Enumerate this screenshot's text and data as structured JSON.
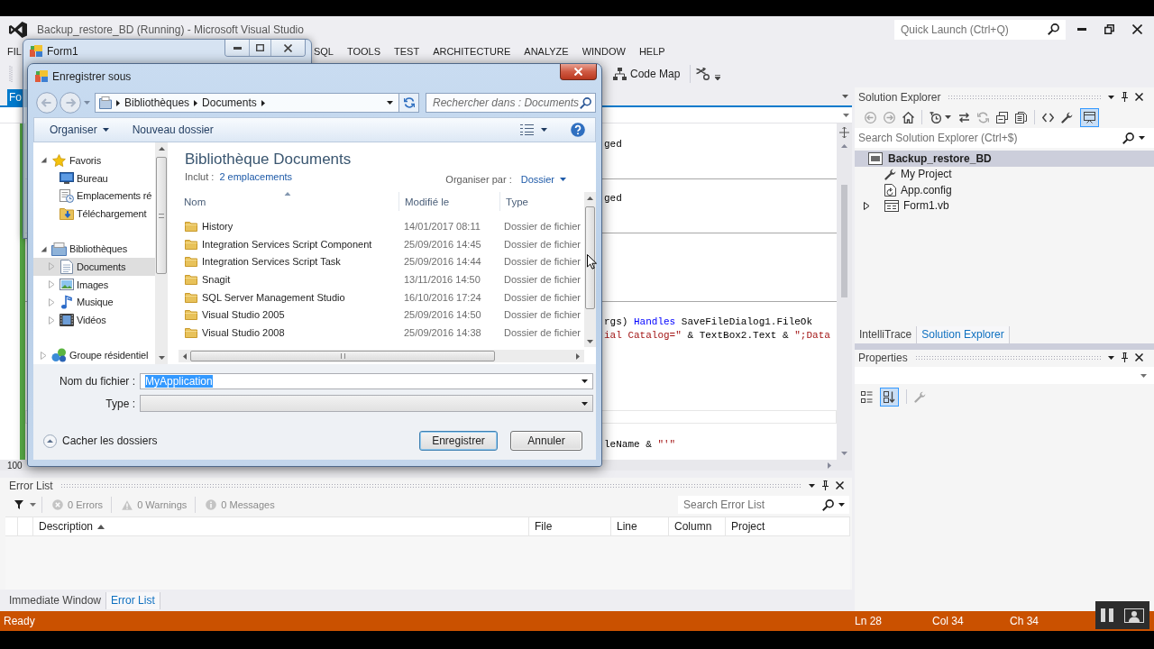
{
  "ide": {
    "title": "Backup_restore_BD (Running) - Microsoft Visual Studio",
    "quick_launch": {
      "placeholder": "Quick Launch (Ctrl+Q)"
    }
  },
  "menu": [
    {
      "label": "FIL"
    },
    {
      "label": "SQL"
    },
    {
      "label": "TOOLS"
    },
    {
      "label": "TEST"
    },
    {
      "label": "ARCHITECTURE"
    },
    {
      "label": "ANALYZE"
    },
    {
      "label": "WINDOW"
    },
    {
      "label": "HELP"
    }
  ],
  "toolbar": {
    "code_map": "Code Map"
  },
  "document_tab": {
    "label": "Fo",
    "selected": true
  },
  "editor": {
    "lines": [
      {
        "tokens": [
          {
            "kind": "plain",
            "text": "ged"
          }
        ]
      },
      {
        "tokens": [
          {
            "kind": "plain",
            "text": "ged"
          }
        ]
      },
      {
        "tokens": [
          {
            "kind": "plain",
            "text": "rgs) "
          },
          {
            "kind": "keyword",
            "text": "Handles"
          },
          {
            "kind": "plain",
            "text": " SaveFileDialog1.FileOk"
          }
        ]
      },
      {
        "tokens": [
          {
            "kind": "string",
            "text": "ial Catalog=\""
          },
          {
            "kind": "plain",
            "text": " & TextBox2.Text & "
          },
          {
            "kind": "string",
            "text": "\";Data"
          }
        ]
      },
      {
        "tokens": [
          {
            "kind": "plain",
            "text": "leName & "
          },
          {
            "kind": "string",
            "text": "\"'\""
          }
        ]
      }
    ],
    "zoom": "100"
  },
  "form_window": {
    "title": "Form1"
  },
  "dialog": {
    "title": "Enregistrer sous",
    "breadcrumb": [
      {
        "label": "Bibliothèques"
      },
      {
        "label": "Documents"
      }
    ],
    "search": {
      "placeholder": "Rechercher dans : Documents"
    },
    "commands": [
      {
        "label": "Organiser",
        "menu": true
      },
      {
        "label": "Nouveau dossier",
        "menu": false
      }
    ],
    "nav": [
      {
        "label": "Favoris",
        "kind": "favorites",
        "selected": false,
        "expanded": true,
        "children": [
          {
            "label": "Bureau",
            "kind": "desktop",
            "selected": false
          },
          {
            "label": "Emplacements ré",
            "kind": "recent",
            "selected": false
          },
          {
            "label": "Téléchargement",
            "kind": "downloads",
            "selected": false
          }
        ]
      },
      {
        "label": "Bibliothèques",
        "kind": "libraries",
        "selected": false,
        "expanded": true,
        "children": [
          {
            "label": "Documents",
            "kind": "documents",
            "selected": true,
            "expanded": false
          },
          {
            "label": "Images",
            "kind": "pictures",
            "selected": false,
            "expanded": false
          },
          {
            "label": "Musique",
            "kind": "music",
            "selected": false,
            "expanded": false
          },
          {
            "label": "Vidéos",
            "kind": "videos",
            "selected": false,
            "expanded": false
          }
        ]
      },
      {
        "label": "Groupe résidentiel",
        "kind": "homegroup",
        "selected": false,
        "expanded": false
      }
    ],
    "library": {
      "title": "Bibliothèque Documents",
      "includes_label": "Inclut :",
      "includes_link": "2 emplacements",
      "arrange_label": "Organiser par :",
      "arrange_value": "Dossier"
    },
    "columns": [
      {
        "label": "Nom",
        "sorted": true
      },
      {
        "label": "Modifié le",
        "sorted": false
      },
      {
        "label": "Type",
        "sorted": false
      }
    ],
    "files": [
      {
        "name": "History",
        "modified": "14/01/2017 08:11",
        "type": "Dossier de fichier"
      },
      {
        "name": "Integration Services Script Component",
        "modified": "25/09/2016 14:45",
        "type": "Dossier de fichier"
      },
      {
        "name": "Integration Services Script Task",
        "modified": "25/09/2016 14:44",
        "type": "Dossier de fichier"
      },
      {
        "name": "Snagit",
        "modified": "13/11/2016 14:50",
        "type": "Dossier de fichier"
      },
      {
        "name": "SQL Server Management Studio",
        "modified": "16/10/2016 17:24",
        "type": "Dossier de fichier"
      },
      {
        "name": "Visual Studio 2005",
        "modified": "25/09/2016 14:50",
        "type": "Dossier de fichier"
      },
      {
        "name": "Visual Studio 2008",
        "modified": "25/09/2016 14:38",
        "type": "Dossier de fichier"
      }
    ],
    "file_name": {
      "label": "Nom du fichier :",
      "value": "MyApplication",
      "text_selected": true
    },
    "file_type": {
      "label": "Type :"
    },
    "hide_folders": "Cacher les dossiers",
    "buttons": [
      {
        "label": "Enregistrer",
        "default": true
      },
      {
        "label": "Annuler",
        "default": false
      }
    ]
  },
  "solution_explorer": {
    "title": "Solution Explorer",
    "toolbar": [
      {
        "pressed": false,
        "disabled": true
      },
      {
        "pressed": false,
        "disabled": true
      },
      {
        "pressed": false,
        "disabled": false
      },
      {
        "pressed": false,
        "disabled": false
      },
      {
        "pressed": false,
        "disabled": false
      },
      {
        "pressed": false,
        "disabled": true
      },
      {
        "pressed": false,
        "disabled": false
      },
      {
        "pressed": false,
        "disabled": false
      },
      {
        "pressed": false,
        "disabled": false
      },
      {
        "pressed": false,
        "disabled": false
      },
      {
        "pressed": true,
        "disabled": false
      }
    ],
    "search": {
      "placeholder": "Search Solution Explorer (Ctrl+$)"
    },
    "tree": [
      {
        "label": "Backup_restore_BD",
        "kind": "project",
        "selected": true,
        "children": [
          {
            "label": "My Project",
            "kind": "properties",
            "selected": false
          },
          {
            "label": "App.config",
            "kind": "config",
            "selected": false
          },
          {
            "label": "Form1.vb",
            "kind": "form",
            "selected": false,
            "expanded": false
          }
        ]
      }
    ]
  },
  "tool_tabs": [
    {
      "label": "IntelliTrace",
      "selected": false
    },
    {
      "label": "Solution Explorer",
      "selected": true
    }
  ],
  "properties": {
    "title": "Properties",
    "toolbar": [
      {
        "pressed": false,
        "disabled": false
      },
      {
        "pressed": true,
        "disabled": false
      },
      {
        "pressed": false,
        "disabled": true
      }
    ]
  },
  "error_list": {
    "title": "Error List",
    "filters": [
      {
        "label": "0 Errors",
        "kind": "error",
        "disabled": true
      },
      {
        "label": "0 Warnings",
        "kind": "warning",
        "disabled": true
      },
      {
        "label": "0 Messages",
        "kind": "message",
        "disabled": true
      }
    ],
    "search": {
      "placeholder": "Search Error List"
    },
    "columns": [
      {
        "label": "Description",
        "sorted": true
      },
      {
        "label": "File",
        "sorted": false
      },
      {
        "label": "Line",
        "sorted": false
      },
      {
        "label": "Column",
        "sorted": false
      },
      {
        "label": "Project",
        "sorted": false
      }
    ]
  },
  "bottom_tabs": [
    {
      "label": "Immediate Window",
      "selected": false
    },
    {
      "label": "Error List",
      "selected": true
    }
  ],
  "status_bar": {
    "message": "Ready",
    "line": "Ln 28",
    "column": "Col 34",
    "char": "Ch 34"
  }
}
